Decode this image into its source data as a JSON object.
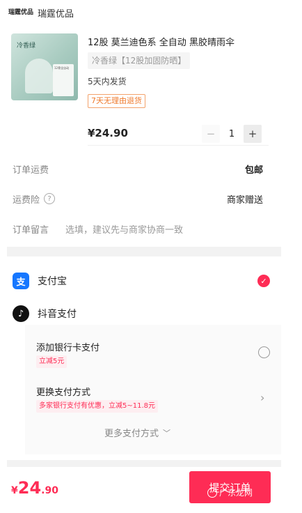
{
  "store": {
    "logo_text": "瑞霆优品",
    "name": "瑞霆优品"
  },
  "product": {
    "image_tag": "冷香绿",
    "image_card_text": "12骨全自动",
    "title": "12股 莫兰迪色系 全自动 黑胶晴雨伞",
    "sku": "冷香绿【12股加固防晒】",
    "shipping": "5天内发货",
    "return_badge": "7天无理由退货",
    "price": "¥24.90",
    "quantity": "1",
    "minus": "−",
    "plus": "+"
  },
  "order": {
    "freight_label": "订单运费",
    "freight_value": "包邮",
    "insurance_label": "运费险",
    "insurance_value": "商家赠送",
    "remark_label": "订单留言",
    "remark_placeholder": "选填，建议先与商家协商一致"
  },
  "payment": {
    "alipay_label": "支付宝",
    "alipay_icon": "alipay-icon",
    "douyin_label": "抖音支付",
    "douyin_icon": "douyin-icon",
    "bank_card_label": "添加银行卡支付",
    "bank_card_promo": "立减5元",
    "change_method_label": "更换支付方式",
    "change_method_promo": "多家银行支付有优惠，立减5~11.8元",
    "more_methods": "更多支付方式"
  },
  "footer": {
    "currency": "¥",
    "total_int": "24",
    "total_dec": ".90",
    "submit_label": "提交订单",
    "watermark": "广东龙网"
  },
  "colors": {
    "accent": "#fe2c55",
    "alipay": "#1677ff",
    "return_badge": "#ef7a2d"
  }
}
